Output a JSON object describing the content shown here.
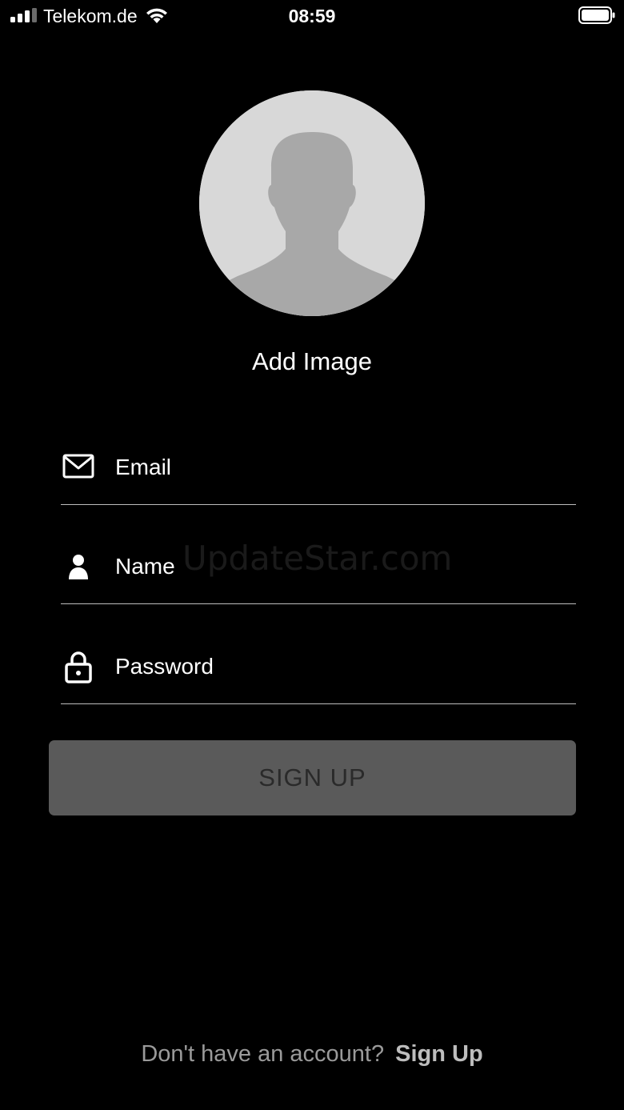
{
  "status_bar": {
    "carrier": "Telekom.de",
    "time": "08:59",
    "signal_icon": "signal-bars-icon",
    "wifi_icon": "wifi-icon",
    "battery_icon": "battery-full-icon"
  },
  "profile": {
    "avatar_icon": "person-silhouette-icon",
    "add_image_label": "Add Image"
  },
  "form": {
    "email": {
      "placeholder": "Email",
      "value": "",
      "icon": "envelope-icon"
    },
    "name": {
      "placeholder": "Name",
      "value": "",
      "icon": "person-icon"
    },
    "password": {
      "placeholder": "Password",
      "value": "",
      "icon": "lock-icon"
    },
    "submit_label": "SIGN UP"
  },
  "watermark": "UpdateStar.com",
  "footer": {
    "prompt": "Don't have an account?",
    "link": "Sign Up"
  },
  "colors": {
    "background": "#000000",
    "button": "#5a5a5a",
    "button_text": "#2a2a2a",
    "avatar_bg": "#d8d8d8",
    "avatar_silhouette": "#a8a8a8"
  }
}
